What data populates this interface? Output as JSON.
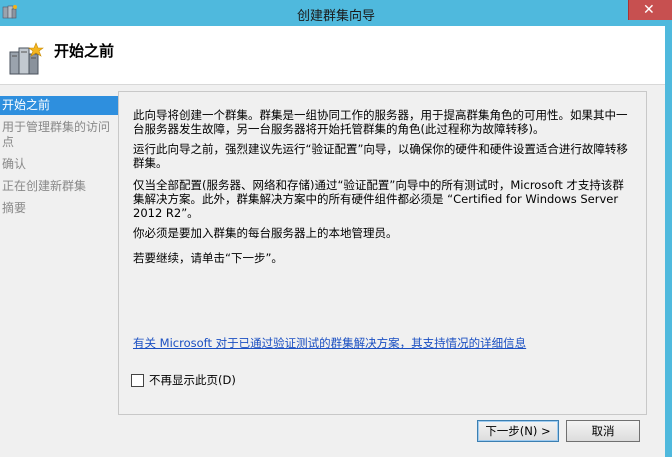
{
  "window": {
    "title": "创建群集向导",
    "close_glyph": "✕",
    "accent": "#4fb9dd",
    "close_color": "#c75050"
  },
  "header": {
    "title": "开始之前",
    "icon": "cluster-servers-icon"
  },
  "nav": {
    "items": [
      {
        "label": "开始之前",
        "active": true
      },
      {
        "label": "用于管理群集的访问点",
        "active": false
      },
      {
        "label": "确认",
        "active": false
      },
      {
        "label": "正在创建新群集",
        "active": false
      },
      {
        "label": "摘要",
        "active": false
      }
    ],
    "selected_color": "#2e8fde"
  },
  "content": {
    "para1": "此向导将创建一个群集。群集是一组协同工作的服务器，用于提高群集角色的可用性。如果其中一台服务器发生故障，另一台服务器将开始托管群集的角色(此过程称为故障转移)。",
    "para2": "运行此向导之前，强烈建议先运行“验证配置”向导，以确保你的硬件和硬件设置适合进行故障转移群集。",
    "para3": "仅当全部配置(服务器、网络和存储)通过“验证配置”向导中的所有测试时，Microsoft 才支持该群集解决方案。此外，群集解决方案中的所有硬件组件都必须是 “Certified for Windows Server 2012 R2”。",
    "para4": "你必须是要加入群集的每台服务器上的本地管理员。",
    "para5": "若要继续，请单击“下一步”。",
    "link": "有关 Microsoft 对于已通过验证测试的群集解决方案，其支持情况的详细信息",
    "checkbox_label": "不再显示此页(D)",
    "checkbox_checked": false
  },
  "footer": {
    "next_label": "下一步(N) >",
    "cancel_label": "取消"
  }
}
